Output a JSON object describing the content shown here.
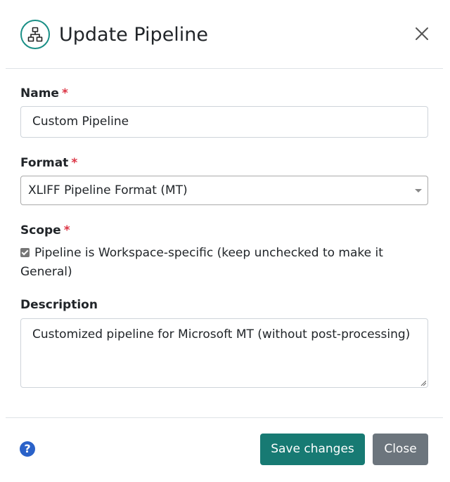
{
  "dialog": {
    "title": "Update Pipeline",
    "icon": "sitemap-icon",
    "close_icon": "close-icon"
  },
  "form": {
    "name": {
      "label": "Name",
      "required_marker": "*",
      "value": "Custom Pipeline"
    },
    "format": {
      "label": "Format",
      "required_marker": "*",
      "selected": "XLIFF Pipeline Format (MT)"
    },
    "scope": {
      "label": "Scope",
      "required_marker": "*",
      "checkbox_label": "Pipeline is Workspace-specific (keep unchecked to make it General)",
      "checked": true
    },
    "description": {
      "label": "Description",
      "value": "Customized pipeline for Microsoft MT (without post-processing)"
    }
  },
  "footer": {
    "help_icon": "question-circle-icon",
    "help_glyph": "?",
    "save_label": "Save changes",
    "close_label": "Close"
  },
  "colors": {
    "accent": "#177a73",
    "required": "#dc3545",
    "secondary": "#6c757d",
    "help": "#2a62c9"
  }
}
